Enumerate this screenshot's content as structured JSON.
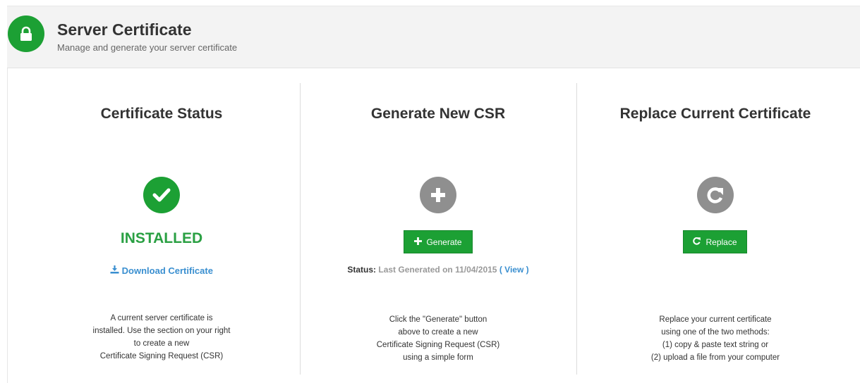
{
  "header": {
    "title": "Server Certificate",
    "subtitle": "Manage and generate your server certificate",
    "icon": "lock-icon",
    "accent": "#1ca034"
  },
  "status_panel": {
    "title": "Certificate Status",
    "icon": "check-circle-icon",
    "state": "INSTALLED",
    "download_label": "Download Certificate",
    "description": [
      "A current server certificate is",
      "installed. Use the section on your right",
      "to create a new",
      "Certificate Signing Request (CSR)"
    ]
  },
  "csr_panel": {
    "title": "Generate New CSR",
    "icon": "plus-circle-icon",
    "button_label": "Generate",
    "status_label": "Status:",
    "status_text": "Last Generated on 11/04/2015",
    "paren_open": "(",
    "view_label": "View",
    "paren_close": ")",
    "description": [
      "Click the \"Generate\" button",
      "above to create a new",
      "Certificate Signing Request (CSR)",
      "using a simple form"
    ]
  },
  "replace_panel": {
    "title": "Replace Current Certificate",
    "icon": "refresh-circle-icon",
    "button_label": "Replace",
    "description": [
      "Replace your current certificate",
      "using one of the two methods:",
      "(1) copy & paste text string or",
      "(2) upload a file from your computer"
    ]
  },
  "colors": {
    "green": "#1ca034",
    "installed_text": "#2aa043",
    "link": "#3a8fd0",
    "gray_icon": "#8f8f8f"
  }
}
